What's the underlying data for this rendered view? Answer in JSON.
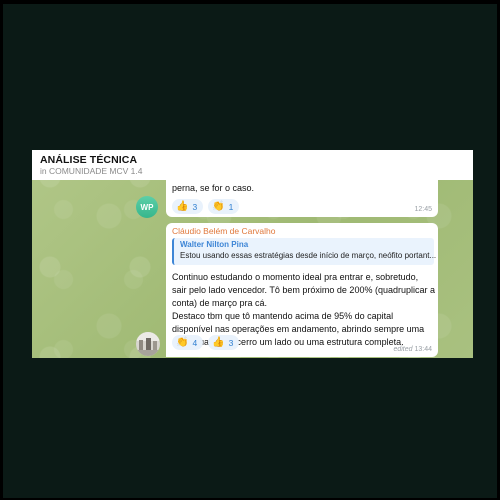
{
  "header": {
    "title": "ANÁLISE TÉCNICA",
    "subtitle": "in COMUNIDADE MCV 1.4"
  },
  "messages": [
    {
      "avatar_initials": "WP",
      "avatar_color": "#3dbb92",
      "text_visible": "perna, se for o caso.",
      "reactions": [
        {
          "icon": "thumbs-up",
          "emoji": "👍",
          "count": "3"
        },
        {
          "icon": "clapping-hands",
          "emoji": "👏",
          "count": "1"
        }
      ],
      "time": "12:45"
    },
    {
      "sender": "Cláudio Belém de Carvalho",
      "reply": {
        "name": "Walter Nilton Pina",
        "text": "Estou usando essas estratégias desde início de março, neófito portant..."
      },
      "lines": [
        "Continuo estudando o momento ideal pra entrar e, sobretudo,",
        "sair pelo lado vencedor. Tô bem próximo de 200% (quadruplicar a",
        "conta) de março pra cá.",
        "Destaco tbm que tô mantendo acima de 95% do capital",
        "disponível nas operações em andamento, abrindo sempre uma",
        "nova quando encerro um lado ou uma estrutura completa."
      ],
      "reactions": [
        {
          "icon": "clapping-hands",
          "emoji": "👏",
          "count": "4"
        },
        {
          "icon": "thumbs-up",
          "emoji": "👍",
          "count": "3"
        }
      ],
      "edited_label": "edited",
      "time": "13:44"
    }
  ]
}
